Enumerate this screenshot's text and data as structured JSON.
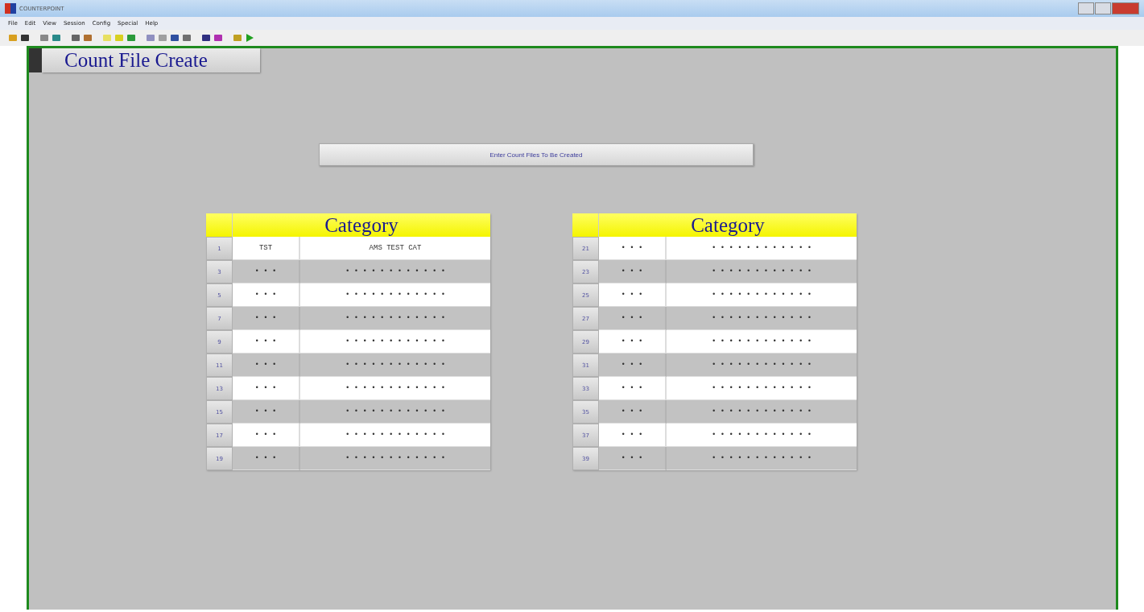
{
  "window": {
    "title": "COUNTERPOINT"
  },
  "menu": [
    "File",
    "Edit",
    "View",
    "Session",
    "Config",
    "Special",
    "Help"
  ],
  "form": {
    "title": "Count File Create",
    "prompt_button": "Enter Count Files To Be Created"
  },
  "tables": [
    {
      "header": "Category",
      "rows": [
        {
          "number": "1",
          "code": "TST",
          "description": "AMS TEST CAT"
        },
        {
          "number": "3",
          "code": "• • •",
          "description": "• • • • • • • • • • • •"
        },
        {
          "number": "5",
          "code": "• • •",
          "description": "• • • • • • • • • • • •"
        },
        {
          "number": "7",
          "code": "• • •",
          "description": "• • • • • • • • • • • •"
        },
        {
          "number": "9",
          "code": "• • •",
          "description": "• • • • • • • • • • • •"
        },
        {
          "number": "11",
          "code": "• • •",
          "description": "• • • • • • • • • • • •"
        },
        {
          "number": "13",
          "code": "• • •",
          "description": "• • • • • • • • • • • •"
        },
        {
          "number": "15",
          "code": "• • •",
          "description": "• • • • • • • • • • • •"
        },
        {
          "number": "17",
          "code": "• • •",
          "description": "• • • • • • • • • • • •"
        },
        {
          "number": "19",
          "code": "• • •",
          "description": "• • • • • • • • • • • •"
        }
      ]
    },
    {
      "header": "Category",
      "rows": [
        {
          "number": "21",
          "code": "• • •",
          "description": "• • • • • • • • • • • •"
        },
        {
          "number": "23",
          "code": "• • •",
          "description": "• • • • • • • • • • • •"
        },
        {
          "number": "25",
          "code": "• • •",
          "description": "• • • • • • • • • • • •"
        },
        {
          "number": "27",
          "code": "• • •",
          "description": "• • • • • • • • • • • •"
        },
        {
          "number": "29",
          "code": "• • •",
          "description": "• • • • • • • • • • • •"
        },
        {
          "number": "31",
          "code": "• • •",
          "description": "• • • • • • • • • • • •"
        },
        {
          "number": "33",
          "code": "• • •",
          "description": "• • • • • • • • • • • •"
        },
        {
          "number": "35",
          "code": "• • •",
          "description": "• • • • • • • • • • • •"
        },
        {
          "number": "37",
          "code": "• • •",
          "description": "• • • • • • • • • • • •"
        },
        {
          "number": "39",
          "code": "• • •",
          "description": "• • • • • • • • • • • •"
        }
      ]
    }
  ]
}
